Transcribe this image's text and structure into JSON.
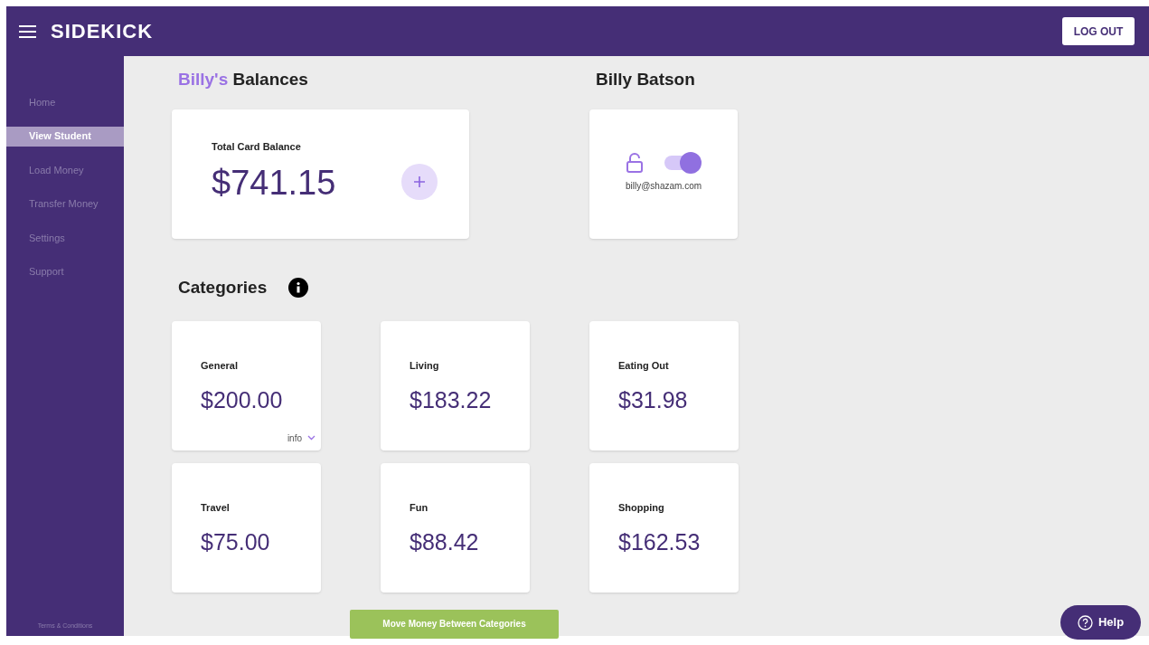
{
  "header": {
    "logo": "SIDEKICK",
    "logout": "LOG OUT"
  },
  "sidebar": {
    "items": [
      {
        "label": "Home",
        "selected": false
      },
      {
        "label": "View Student",
        "selected": true
      },
      {
        "label": "Load Money",
        "selected": false
      },
      {
        "label": "Transfer Money",
        "selected": false
      },
      {
        "label": "Settings",
        "selected": false
      },
      {
        "label": "Support",
        "selected": false
      }
    ],
    "footer": "Terms & Conditions"
  },
  "balances": {
    "owner": "Billy's",
    "title": "Balances",
    "card_label": "Total Card Balance",
    "amount": "$741.15"
  },
  "student": {
    "name": "Billy Batson",
    "email": "billy@shazam.com",
    "unlocked": true,
    "card_on": true
  },
  "categories": {
    "title": "Categories",
    "items": [
      {
        "name": "General",
        "amount": "$200.00",
        "info": "info"
      },
      {
        "name": "Living",
        "amount": "$183.22"
      },
      {
        "name": "Eating Out",
        "amount": "$31.98"
      },
      {
        "name": "Travel",
        "amount": "$75.00"
      },
      {
        "name": "Fun",
        "amount": "$88.42"
      },
      {
        "name": "Shopping",
        "amount": "$162.53"
      }
    ]
  },
  "move_button": "Move Money Between Categories",
  "help": "Help"
}
